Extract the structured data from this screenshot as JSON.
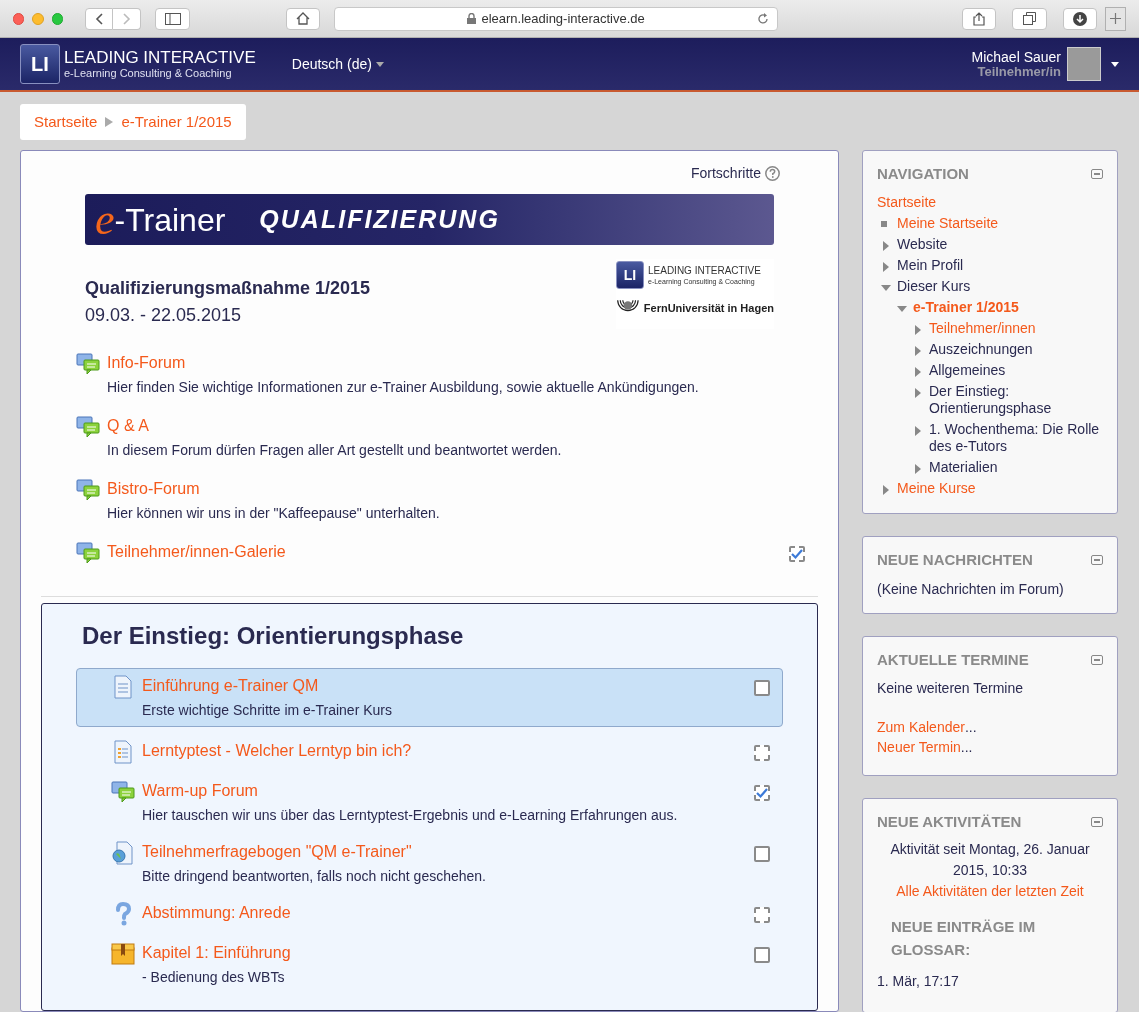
{
  "browser": {
    "url": "elearn.leading-interactive.de"
  },
  "header": {
    "logo_mark": "LI",
    "logo_title": "LEADING INTERACTIVE",
    "logo_subtitle": "e-Learning Consulting & Coaching",
    "language": "Deutsch (de)",
    "user_name": "Michael Sauer",
    "user_role": "Teilnehmer/in"
  },
  "breadcrumb": [
    "Startseite",
    "e-Trainer 1/2015"
  ],
  "course": {
    "progress_label": "Fortschritte",
    "banner_e": "e",
    "banner_trainer": "-Trainer",
    "banner_subtitle": "QUALIFIZIERUNG",
    "title": "Qualifizierungsmaßnahme 1/2015",
    "dates": "09.03. - 22.05.2015",
    "partner_mark": "LI",
    "partner_title": "LEADING INTERACTIVE",
    "partner_subtitle": "e-Learning Consulting & Coaching",
    "university": "FernUniversität in Hagen"
  },
  "sections": [
    {
      "items": [
        {
          "kind": "forum",
          "title": "Info-Forum",
          "description": "Hier finden Sie wichtige Informationen zur e-Trainer Ausbildung, sowie aktuelle Ankündigungen.",
          "highlighted": false
        },
        {
          "kind": "forum",
          "title": "Q & A",
          "description": "In diesem Forum dürfen Fragen aller Art gestellt und beantwortet werden.",
          "highlighted": false
        },
        {
          "kind": "forum",
          "title": "Bistro-Forum",
          "description": "Hier können wir uns in der \"Kaffeepause\" unterhalten.",
          "highlighted": false
        },
        {
          "kind": "forum",
          "title": "Teilnehmer/innen-Galerie",
          "highlighted": false,
          "completion": {
            "kind": "auto",
            "checked": true
          }
        }
      ]
    },
    {
      "title": "Der Einstieg: Orientierungsphase",
      "items": [
        {
          "kind": "page",
          "title": "Einführung e-Trainer QM",
          "description": "Erste wichtige Schritte im e-Trainer Kurs",
          "highlighted": true,
          "completion": {
            "kind": "manual",
            "checked": false
          }
        },
        {
          "kind": "survey",
          "title": "Lerntyptest - Welcher Lerntyp bin ich?",
          "highlighted": false,
          "completion": {
            "kind": "auto",
            "checked": false
          }
        },
        {
          "kind": "forum",
          "title": "Warm-up Forum",
          "description": "Hier tauschen wir uns über das Lerntyptest-Ergebnis und e-Learning Erfahrungen aus.",
          "highlighted": false,
          "completion": {
            "kind": "auto",
            "checked": true
          }
        },
        {
          "kind": "url",
          "title": "Teilnehmerfragebogen \"QM e-Trainer\"",
          "description": "Bitte dringend beantworten, falls noch nicht geschehen.",
          "highlighted": false,
          "completion": {
            "kind": "manual",
            "checked": false
          }
        },
        {
          "kind": "choice",
          "title": "Abstimmung: Anrede",
          "highlighted": false,
          "completion": {
            "kind": "auto",
            "checked": false
          }
        },
        {
          "kind": "book",
          "title": "Kapitel 1: Einführung",
          "description": "- Bedienung des WBTs",
          "highlighted": false,
          "completion": {
            "kind": "manual",
            "checked": false
          }
        }
      ]
    }
  ],
  "navigation": {
    "title": "NAVIGATION",
    "root": "Startseite",
    "items": [
      {
        "label": "Meine Startseite",
        "kind": "leaf",
        "link": true,
        "current": false
      },
      {
        "label": "Website",
        "kind": "branch",
        "expanded": false,
        "link": false,
        "current": false
      },
      {
        "label": "Mein Profil",
        "kind": "branch",
        "expanded": false,
        "link": false,
        "current": false
      },
      {
        "label": "Dieser Kurs",
        "kind": "branch",
        "expanded": true,
        "link": false,
        "current": false,
        "children": [
          {
            "label": "e-Trainer 1/2015",
            "kind": "branch",
            "expanded": true,
            "link": true,
            "current": true,
            "children": [
              {
                "label": "Teilnehmer/innen",
                "kind": "branch",
                "expanded": false,
                "link": true,
                "current": false
              },
              {
                "label": "Auszeichnungen",
                "kind": "branch",
                "expanded": false,
                "link": false,
                "current": false
              },
              {
                "label": "Allgemeines",
                "kind": "branch",
                "expanded": false,
                "link": false,
                "current": false
              },
              {
                "label": "Der Einstieg: Orientierungsphase",
                "kind": "branch",
                "expanded": false,
                "link": false,
                "current": false
              },
              {
                "label": "1. Wochenthema: Die Rolle des e-Tutors",
                "kind": "branch",
                "expanded": false,
                "link": false,
                "current": false
              },
              {
                "label": "Materialien",
                "kind": "branch",
                "expanded": false,
                "link": false,
                "current": false
              }
            ]
          }
        ]
      },
      {
        "label": "Meine Kurse",
        "kind": "branch",
        "expanded": false,
        "link": true,
        "current": false
      }
    ]
  },
  "news": {
    "title": "NEUE NACHRICHTEN",
    "text": "(Keine Nachrichten im Forum)"
  },
  "events": {
    "title": "AKTUELLE TERMINE",
    "text": "Keine weiteren Termine",
    "links": [
      {
        "label": "Zum Kalender",
        "suffix": "..."
      },
      {
        "label": "Neuer Termin",
        "suffix": "..."
      }
    ]
  },
  "activity": {
    "title": "NEUE AKTIVITÄTEN",
    "since": "Aktivität seit Montag, 26. Januar 2015, 10:33",
    "all_link": "Alle Aktivitäten der letzten Zeit",
    "glossary_title": "NEUE EINTRÄGE IM GLOSSAR:",
    "glossary_date": "1. Mär, 17:17"
  }
}
